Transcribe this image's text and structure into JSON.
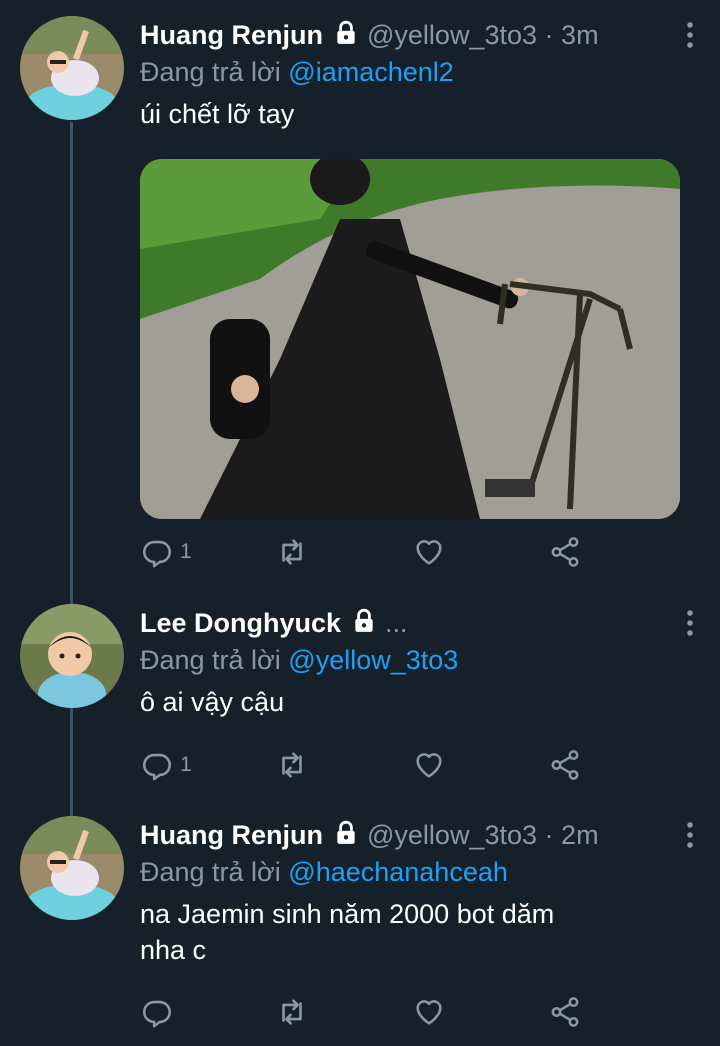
{
  "tweets": [
    {
      "name": "Huang Renjun",
      "handle": "@yellow_3to3",
      "dot": "·",
      "time": "3m",
      "reply_prefix": "Đang trả lời",
      "reply_to": "@iamachenl2",
      "text": "úi chết lỡ tay",
      "reply_count": "1",
      "retweet_count": "",
      "like_count": ""
    },
    {
      "name": "Lee Donghyuck",
      "ellipsis": "...",
      "reply_prefix": "Đang trả lời",
      "reply_to": "@yellow_3to3",
      "text": "ô ai vậy cậu",
      "reply_count": "1",
      "retweet_count": "",
      "like_count": ""
    },
    {
      "name": "Huang Renjun",
      "handle": "@yellow_3to3",
      "dot": "·",
      "time": "2m",
      "reply_prefix": "Đang trả lời",
      "reply_to": "@haechanahceah",
      "text_line1": "na Jaemin sinh năm 2000 bot dăm",
      "text_line2": "nha c",
      "reply_count": "",
      "retweet_count": "",
      "like_count": ""
    }
  ],
  "icons": {
    "lock": "lock-icon",
    "more": "more-vertical-icon",
    "reply": "reply-icon",
    "retweet": "retweet-icon",
    "like": "heart-icon",
    "share": "share-icon"
  },
  "colors": {
    "background": "#15202b",
    "text": "#ffffff",
    "secondary": "#8899a6",
    "link": "#1da1f2",
    "thread_line": "#3d5466"
  }
}
